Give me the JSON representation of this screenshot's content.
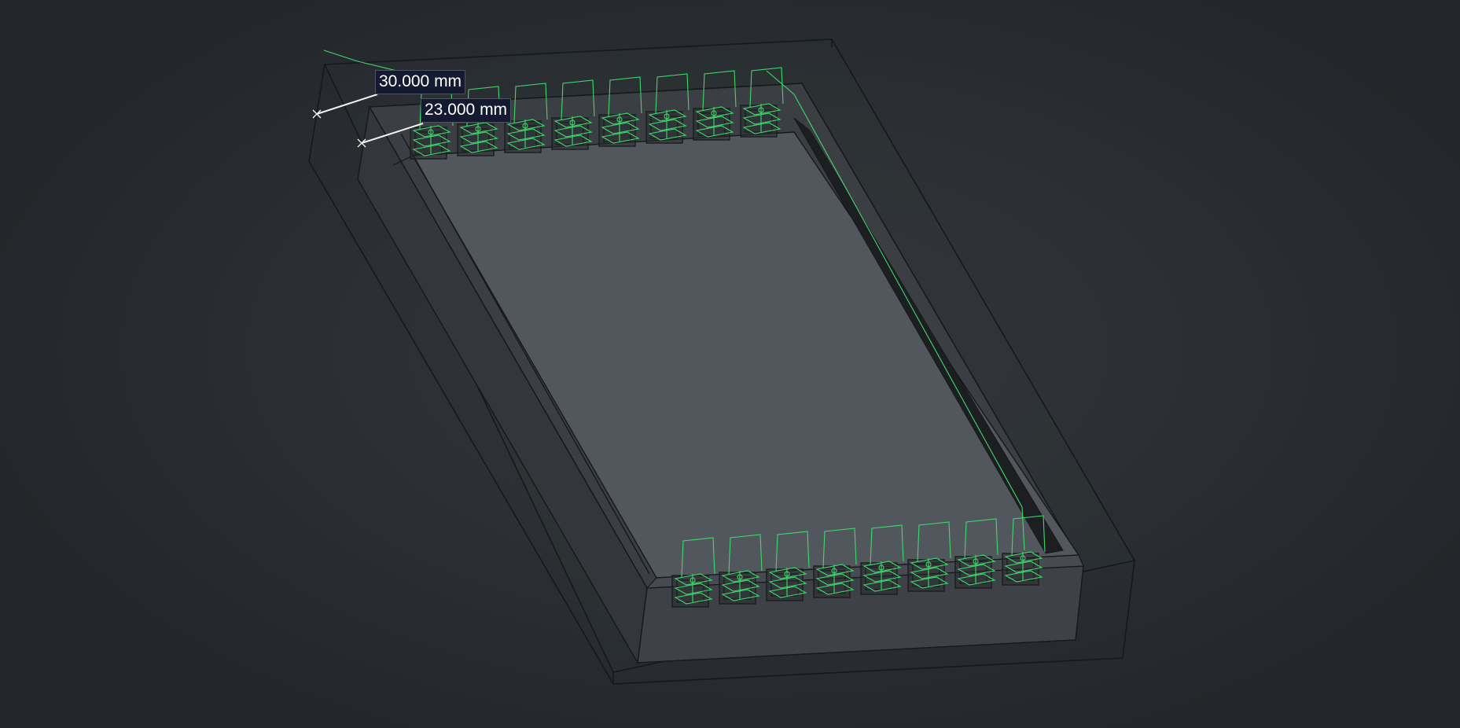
{
  "viewport": {
    "background_color": "#2b2f33"
  },
  "model": {
    "wireframe_color": "#1a1c1e",
    "body_color": "#4f545a",
    "pin_color": "#3fd96b"
  },
  "dimensions": [
    {
      "label": "30.000 mm"
    },
    {
      "label": "23.000 mm"
    }
  ]
}
